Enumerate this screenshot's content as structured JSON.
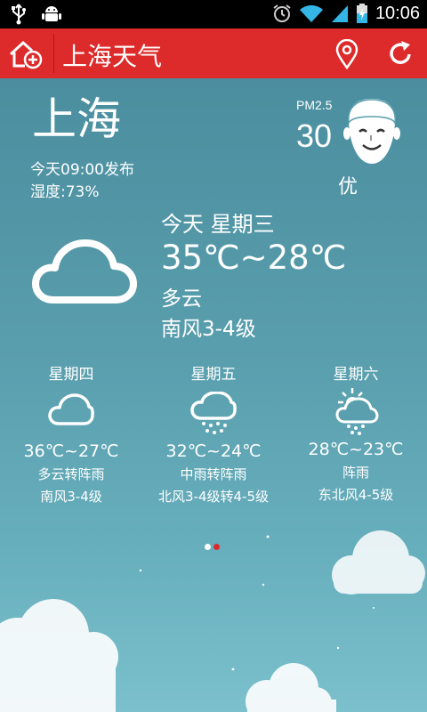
{
  "status_bar": {
    "time": "10:06",
    "icons": [
      "usb-icon",
      "android-debug-icon",
      "alarm-icon",
      "wifi-icon",
      "signal-icon",
      "battery-charging-icon"
    ]
  },
  "app_bar": {
    "title": "上海天气",
    "icons": [
      "home-add-icon",
      "location-pin-icon",
      "refresh-icon"
    ],
    "background": "#dd2a2a"
  },
  "current": {
    "city": "上海",
    "publish_time": "今天09:00发布",
    "humidity": "湿度:73%",
    "pm_label": "PM2.5",
    "pm_value": "30",
    "pm_quality": "优",
    "date_label": "今天 星期三",
    "temp_range": "35℃~28℃",
    "condition": "多云",
    "wind": "南风3-4级",
    "icon": "cloudy-icon"
  },
  "forecast": [
    {
      "day": "星期四",
      "temp": "36℃~27℃",
      "condition": "多云转阵雨",
      "wind": "南风3-4级",
      "icon": "cloudy-icon"
    },
    {
      "day": "星期五",
      "temp": "32℃~24℃",
      "condition": "中雨转阵雨",
      "wind": "北风3-4级转4-5级",
      "icon": "rain-icon"
    },
    {
      "day": "星期六",
      "temp": "28℃~23℃",
      "condition": "阵雨",
      "wind": "东北风4-5级",
      "icon": "shower-icon"
    }
  ],
  "pager": {
    "pages": 2,
    "active": 2,
    "active_color": "#dd2a2a",
    "inactive_color": "#ffffff"
  },
  "colors": {
    "sky_top": "#4b8e9f",
    "sky_bottom": "#7bc0cc"
  }
}
